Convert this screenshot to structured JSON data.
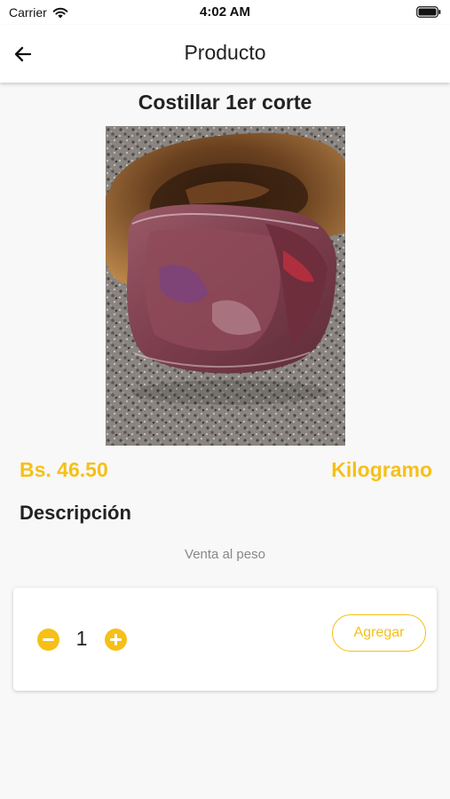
{
  "status_bar": {
    "carrier": "Carrier",
    "time": "4:02 AM",
    "icons": [
      "wifi-icon",
      "battery-icon"
    ]
  },
  "header": {
    "title": "Producto",
    "back_icon": "arrow-left-icon"
  },
  "product": {
    "name": "Costillar 1er corte",
    "price": "Bs. 46.50",
    "unit": "Kilogramo",
    "description_heading": "Descripción",
    "description": "Venta al peso"
  },
  "cart": {
    "quantity": "1",
    "decrement_icon": "minus-circle-icon",
    "increment_icon": "plus-circle-icon",
    "add_label": "Agregar"
  },
  "colors": {
    "accent": "#f6c016",
    "background": "#f8f8f8",
    "text": "#222222",
    "muted_text": "#888888"
  }
}
